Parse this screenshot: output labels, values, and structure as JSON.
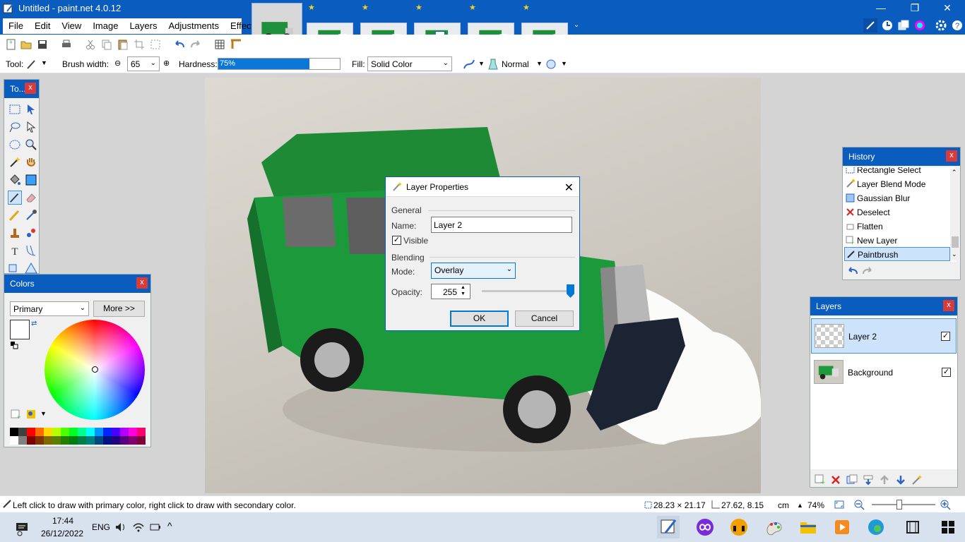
{
  "window": {
    "title": "Untitled - paint.net 4.0.12",
    "minimize": "—",
    "restore": "❐",
    "close": "✕"
  },
  "menu": {
    "items": [
      "File",
      "Edit",
      "View",
      "Image",
      "Layers",
      "Adjustments",
      "Effects"
    ]
  },
  "thumbnails": {
    "count": 6,
    "star": "★"
  },
  "toolbar2": {
    "tool_label": "Tool:",
    "brush_width_label": "Brush width:",
    "brush_width_value": "65",
    "hardness_label": "Hardness:",
    "hardness_value": "75%",
    "hardness_fraction": 0.75,
    "fill_label": "Fill:",
    "fill_value": "Solid Color",
    "blend_mode_value": "Normal"
  },
  "tools_panel": {
    "title": "To...",
    "close": "x"
  },
  "colors_panel": {
    "title": "Colors",
    "close": "x",
    "mode_value": "Primary",
    "more_button": "More >>",
    "palette": [
      "#000000",
      "#404040",
      "#ff0000",
      "#ff6a00",
      "#ffd800",
      "#b6ff00",
      "#4cff00",
      "#00ff21",
      "#00ff90",
      "#00ffff",
      "#0094ff",
      "#0026ff",
      "#4800ff",
      "#b200ff",
      "#ff00dc",
      "#ff006e"
    ],
    "palette_dark": [
      "#ffffff",
      "#808080",
      "#7f0000",
      "#7f3300",
      "#7f6a00",
      "#5b7f00",
      "#267f00",
      "#007f0e",
      "#007f46",
      "#007f7f",
      "#004a7f",
      "#00137f",
      "#21007f",
      "#57007f",
      "#7f006e",
      "#7f0037"
    ]
  },
  "history_panel": {
    "title": "History",
    "close": "x",
    "items": [
      {
        "label": "Rectangle Select",
        "icon": "rectangle-select-icon"
      },
      {
        "label": "Layer Blend Mode",
        "icon": "layer-blend-icon"
      },
      {
        "label": "Gaussian Blur",
        "icon": "gaussian-blur-icon"
      },
      {
        "label": "Deselect",
        "icon": "deselect-icon"
      },
      {
        "label": "Flatten",
        "icon": "flatten-icon"
      },
      {
        "label": "New Layer",
        "icon": "new-layer-icon"
      },
      {
        "label": "Paintbrush",
        "icon": "paintbrush-icon"
      }
    ]
  },
  "layers_panel": {
    "title": "Layers",
    "close": "x",
    "layers": [
      {
        "name": "Layer 2",
        "visible": true
      },
      {
        "name": "Background",
        "visible": true
      }
    ]
  },
  "dialog": {
    "title": "Layer Properties",
    "close": "✕",
    "general_label": "General",
    "name_label": "Name:",
    "name_value": "Layer 2",
    "visible_label": "Visible",
    "blending_label": "Blending",
    "mode_label": "Mode:",
    "mode_value": "Overlay",
    "opacity_label": "Opacity:",
    "opacity_value": "255",
    "opacity_fraction": 1.0,
    "ok": "OK",
    "cancel": "Cancel"
  },
  "statusbar": {
    "hint": "Left click to draw with primary color, right click to draw with secondary color.",
    "selection_size": "28.23 × 21.17",
    "cursor_pos": "27.62, 8.15",
    "units": "cm",
    "zoom": "74%"
  },
  "taskbar": {
    "time": "17:44",
    "date": "26/12/2022",
    "lang": "ENG"
  }
}
